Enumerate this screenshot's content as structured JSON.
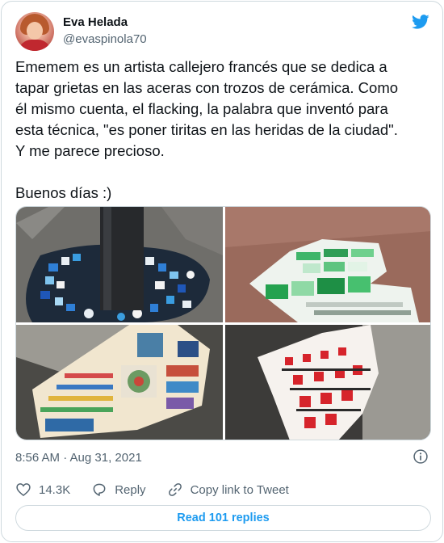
{
  "author": {
    "display_name": "Eva Helada",
    "handle": "@evaspinola70"
  },
  "tweet": {
    "text": "Ememem es un artista callejero francés que se dedica a\ntapar grietas en las aceras con trozos de cerámica. Como\nél mismo cuenta, el flacking, la palabra que inventó para\nesta técnica, \"es poner tiritas en las heridas de la ciudad\".\nY me parece precioso.\n\nBuenos días :)",
    "timestamp": "8:56 AM · Aug 31, 2021"
  },
  "actions": {
    "likes_count": "14.3K",
    "reply_label": "Reply",
    "copy_link_label": "Copy link to Tweet"
  },
  "read_replies_label": "Read 101 replies",
  "colors": {
    "accent": "#1d9bf0",
    "secondary_text": "#536471",
    "border": "#cfd9de"
  },
  "icons": [
    "twitter-bird-icon",
    "info-icon",
    "heart-icon",
    "reply-icon",
    "link-icon"
  ]
}
